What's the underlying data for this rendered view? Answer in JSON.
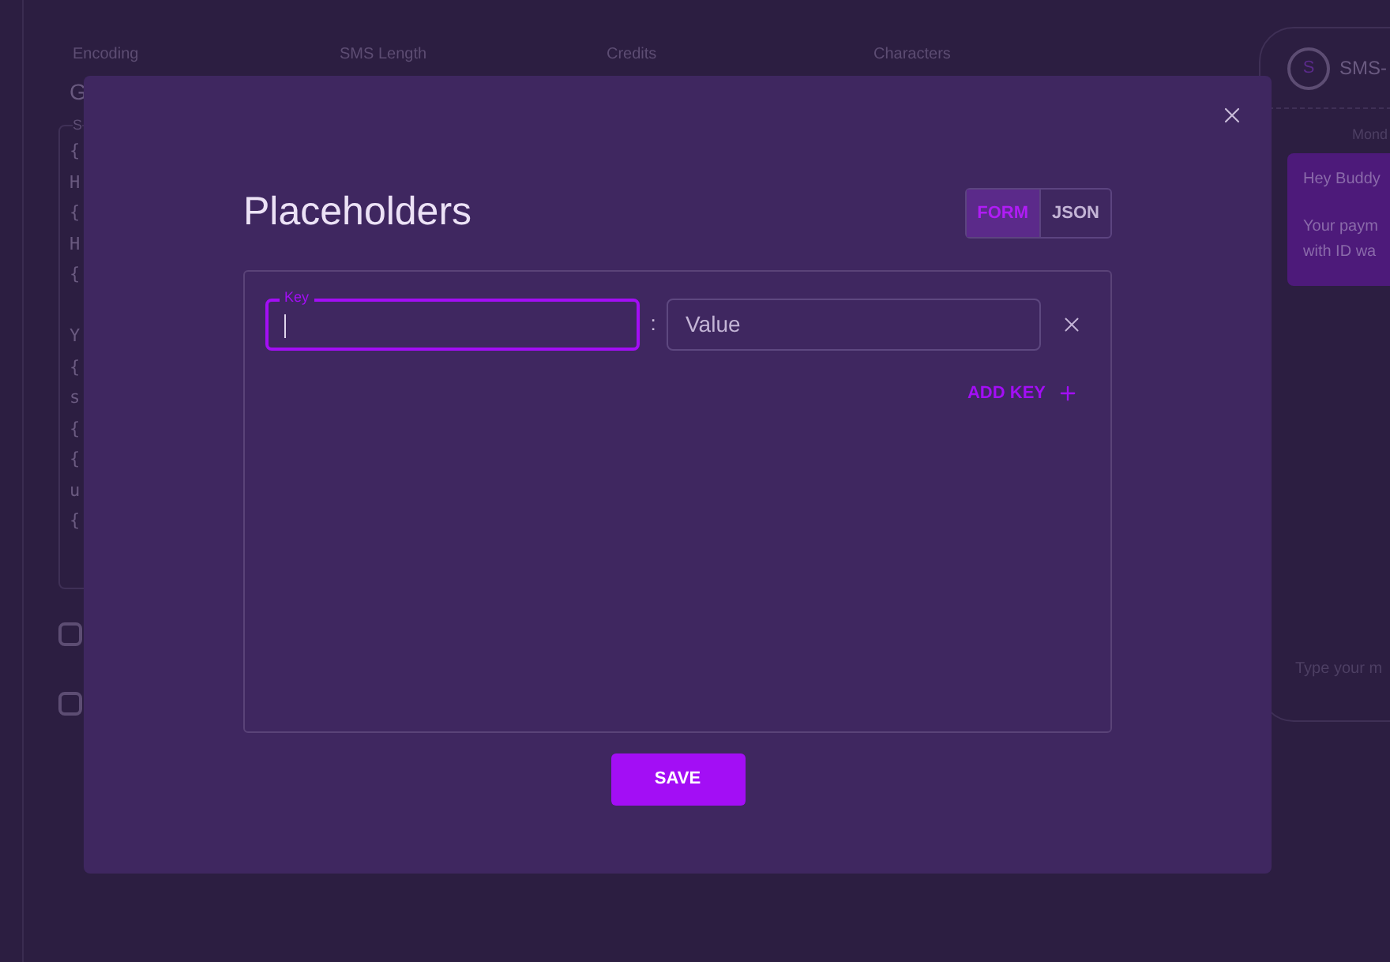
{
  "background": {
    "stats": [
      {
        "label": "Encoding",
        "value": "G"
      },
      {
        "label": "SMS Length"
      },
      {
        "label": "Credits"
      },
      {
        "label": "Characters"
      }
    ],
    "editor": {
      "label": "S",
      "blocks": [
        [
          "{",
          "H",
          "{",
          "H",
          "{"
        ],
        [
          "Y",
          "{",
          "s",
          "{",
          "{",
          "u",
          "{"
        ]
      ]
    },
    "checkboxes": [
      {
        "checked": false
      },
      {
        "checked": false
      }
    ],
    "chat": {
      "avatar": "S",
      "title": "SMS-",
      "date": "Mond",
      "message": [
        "Hey Buddy",
        "Your paym",
        "with ID wa"
      ],
      "placeholder": "Type your m"
    }
  },
  "modal": {
    "title": "Placeholders",
    "tabs": [
      {
        "label": "FORM",
        "selected": true
      },
      {
        "label": "JSON",
        "selected": false
      }
    ],
    "rows": [
      {
        "key_label": "Key",
        "key": "",
        "focused": true,
        "separator": ":",
        "value_placeholder": "Value"
      }
    ],
    "add_key": "ADD KEY",
    "save": "SAVE"
  }
}
